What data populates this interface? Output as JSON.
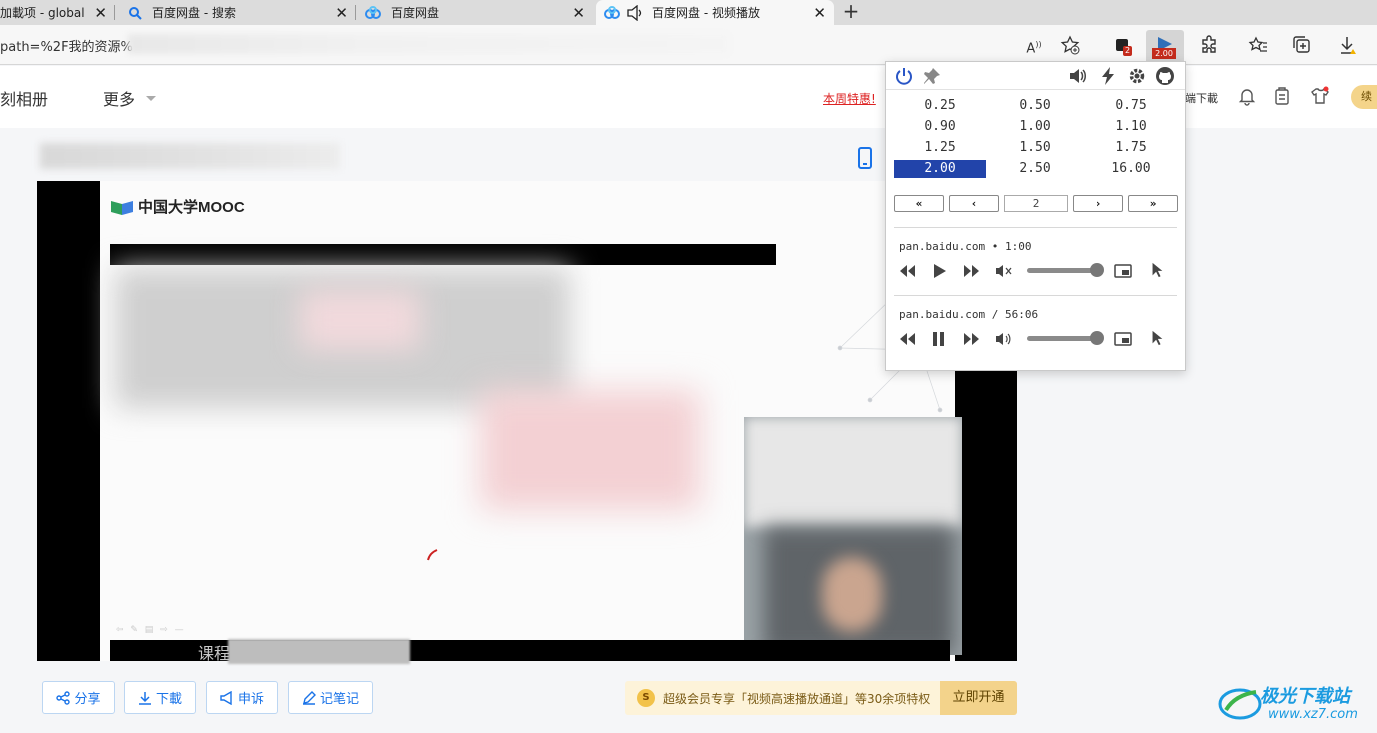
{
  "tabs": [
    {
      "title": "加載项 - global s",
      "icon": "puzzle"
    },
    {
      "title": "百度网盘 - 搜索",
      "icon": "search"
    },
    {
      "title": "百度网盘",
      "icon": "baidu-cloud"
    },
    {
      "title": "百度网盘 - 视频播放",
      "icon": "baidu-cloud",
      "audio": true
    }
  ],
  "address": {
    "url": "path=%2F我的资源%"
  },
  "toolbar": {
    "ext_badge": "2",
    "speed_badge": "2.00"
  },
  "header": {
    "nav_album": "刻相册",
    "nav_more": "更多",
    "promo": "本周特惠!",
    "client_download": "端下載",
    "vip_pill": "续"
  },
  "video": {
    "logo_text": "中国大学MOOC",
    "caption": "课程"
  },
  "actions": {
    "share": "分享",
    "download": "下載",
    "report": "申诉",
    "notes": "记笔记"
  },
  "vip_banner": {
    "coin": "S",
    "text": "超级会员专享「视频高速播放通道」等30余项特权",
    "button": "立即开通"
  },
  "watermark": {
    "title": "极光下载站",
    "url": "www.xz7.com"
  },
  "popup": {
    "speeds": [
      "0.25",
      "0.50",
      "0.75",
      "0.90",
      "1.00",
      "1.10",
      "1.25",
      "1.50",
      "1.75",
      "2.00",
      "2.50",
      "16.00"
    ],
    "selected_speed": "2.00",
    "step_value": "2",
    "media": [
      {
        "title": "pan.baidu.com • 1:00",
        "state": "paused",
        "muted": true,
        "volume": 1.0
      },
      {
        "title": "pan.baidu.com / 56:06",
        "state": "playing",
        "muted": false,
        "volume": 1.0
      }
    ]
  }
}
